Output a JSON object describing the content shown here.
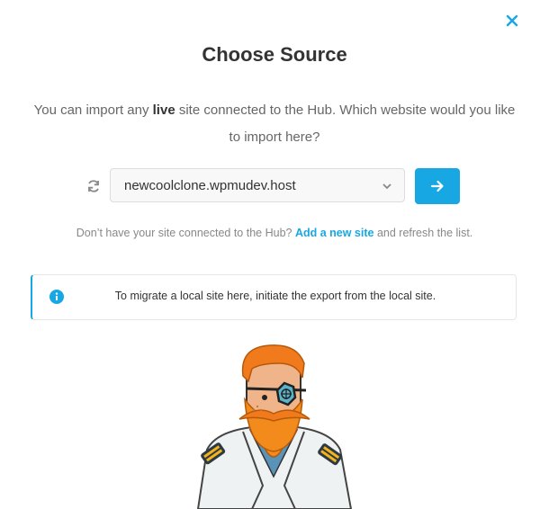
{
  "dialog": {
    "title": "Choose Source",
    "description_before": "You can import any ",
    "description_emphasis": "live",
    "description_after": " site connected to the Hub. Which website would you like to import here?"
  },
  "source": {
    "selected_site": "newcoolclone.wpmudev.host"
  },
  "hint": {
    "before": "Don’t have your site connected to the Hub? ",
    "link": "Add a new site",
    "after": " and refresh the list."
  },
  "notice": {
    "text": "To migrate a local site here, initiate the export from the local site."
  },
  "icons": {
    "close": "close-icon",
    "refresh": "refresh-icon",
    "chevron": "chevron-down-icon",
    "arrow": "arrow-right-icon",
    "info": "info-icon"
  },
  "colors": {
    "accent": "#17a8e3",
    "title": "#333333",
    "muted": "#888888"
  }
}
